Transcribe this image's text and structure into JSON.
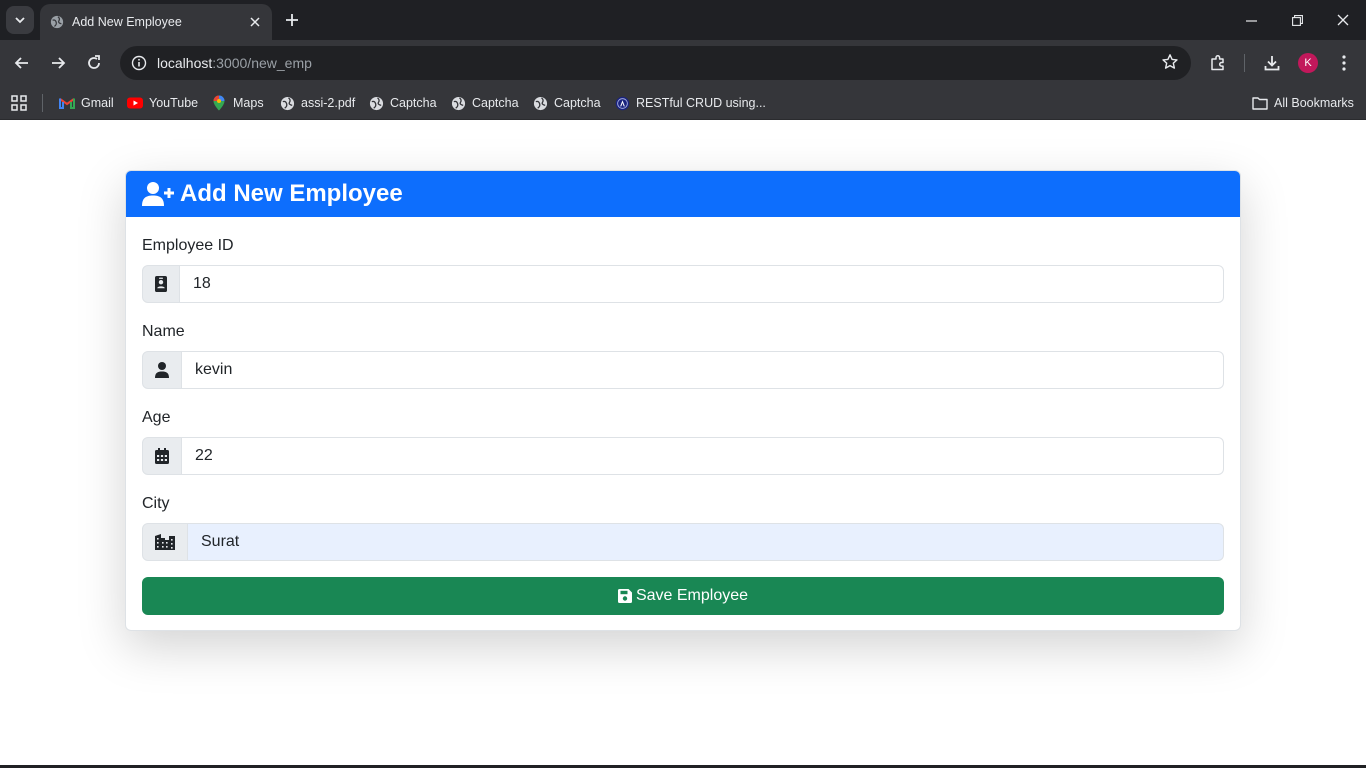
{
  "browser": {
    "tab_title": "Add New Employee",
    "url_host": "localhost",
    "url_path": ":3000/new_emp",
    "profile_initial": "K",
    "bookmarks": [
      "Gmail",
      "YouTube",
      "Maps",
      "assi-2.pdf",
      "Captcha",
      "Captcha",
      "Captcha",
      "RESTful CRUD using..."
    ],
    "all_bookmarks": "All Bookmarks"
  },
  "form": {
    "title": "Add New Employee",
    "fields": [
      {
        "label": "Employee ID",
        "value": "18",
        "icon": "id-badge-icon"
      },
      {
        "label": "Name",
        "value": "kevin",
        "icon": "user-icon"
      },
      {
        "label": "Age",
        "value": "22",
        "icon": "calendar-icon"
      },
      {
        "label": "City",
        "value": "Surat",
        "icon": "city-icon"
      }
    ],
    "submit_label": "Save Employee"
  },
  "colors": {
    "header": "#0d6efd",
    "submit": "#198754",
    "autofill": "#e8f0fe"
  }
}
